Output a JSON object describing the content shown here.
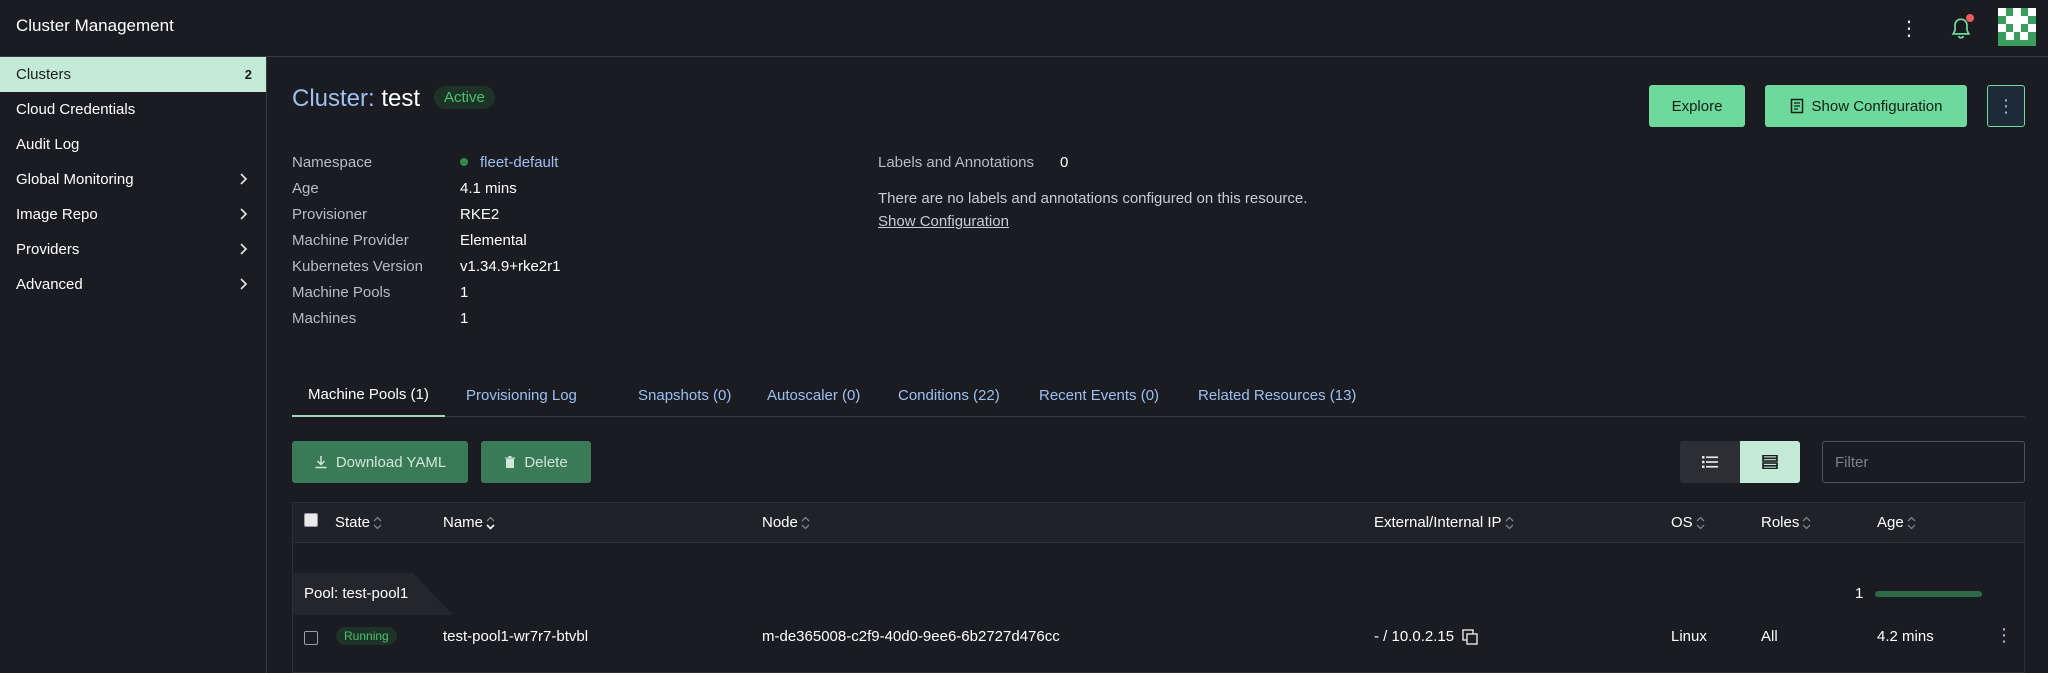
{
  "header": {
    "app_title": "Cluster Management"
  },
  "sidebar": {
    "items": [
      {
        "label": "Clusters",
        "count": "2"
      },
      {
        "label": "Cloud Credentials"
      },
      {
        "label": "Audit Log"
      },
      {
        "label": "Global Monitoring"
      },
      {
        "label": "Image Repo"
      },
      {
        "label": "Providers"
      },
      {
        "label": "Advanced"
      }
    ]
  },
  "page": {
    "title_prefix": "Cluster:",
    "title_name": "test",
    "status": "Active",
    "explore_label": "Explore",
    "show_config_label": "Show Configuration"
  },
  "details": [
    {
      "label": "Namespace",
      "value": "fleet-default"
    },
    {
      "label": "Age",
      "value": "4.1 mins"
    },
    {
      "label": "Provisioner",
      "value": "RKE2"
    },
    {
      "label": "Machine Provider",
      "value": "Elemental"
    },
    {
      "label": "Kubernetes Version",
      "value": "v1.34.9+rke2r1"
    },
    {
      "label": "Machine Pools",
      "value": "1"
    },
    {
      "label": "Machines",
      "value": "1"
    }
  ],
  "labels_annotations": {
    "label": "Labels and Annotations",
    "count": "0",
    "message": "There are no labels and annotations configured on this resource.",
    "link": "Show Configuration"
  },
  "tabs": [
    "Machine Pools (1)",
    "Provisioning Log",
    "Snapshots (0)",
    "Autoscaler (0)",
    "Conditions (22)",
    "Recent Events (0)",
    "Related Resources (13)"
  ],
  "actions": {
    "download_label": "Download YAML",
    "delete_label": "Delete",
    "filter_placeholder": "Filter"
  },
  "table": {
    "columns": [
      "State",
      "Name",
      "Node",
      "External/Internal IP",
      "OS",
      "Roles",
      "Age"
    ],
    "group": {
      "label": "Pool: test-pool1",
      "count": "1"
    },
    "rows": [
      {
        "state": "Running",
        "name": "test-pool1-wr7r7-btvbl",
        "node": "m-de365008-c2f9-40d0-9ee6-6b2727d476cc",
        "ip": "- / 10.0.2.15",
        "os": "Linux",
        "roles": "All",
        "age": "4.2 mins"
      }
    ]
  },
  "colors": {
    "accent": "#6ed99c",
    "link": "#9cc0f2",
    "active_status": "#49c16f",
    "background": "#1b1c21"
  }
}
